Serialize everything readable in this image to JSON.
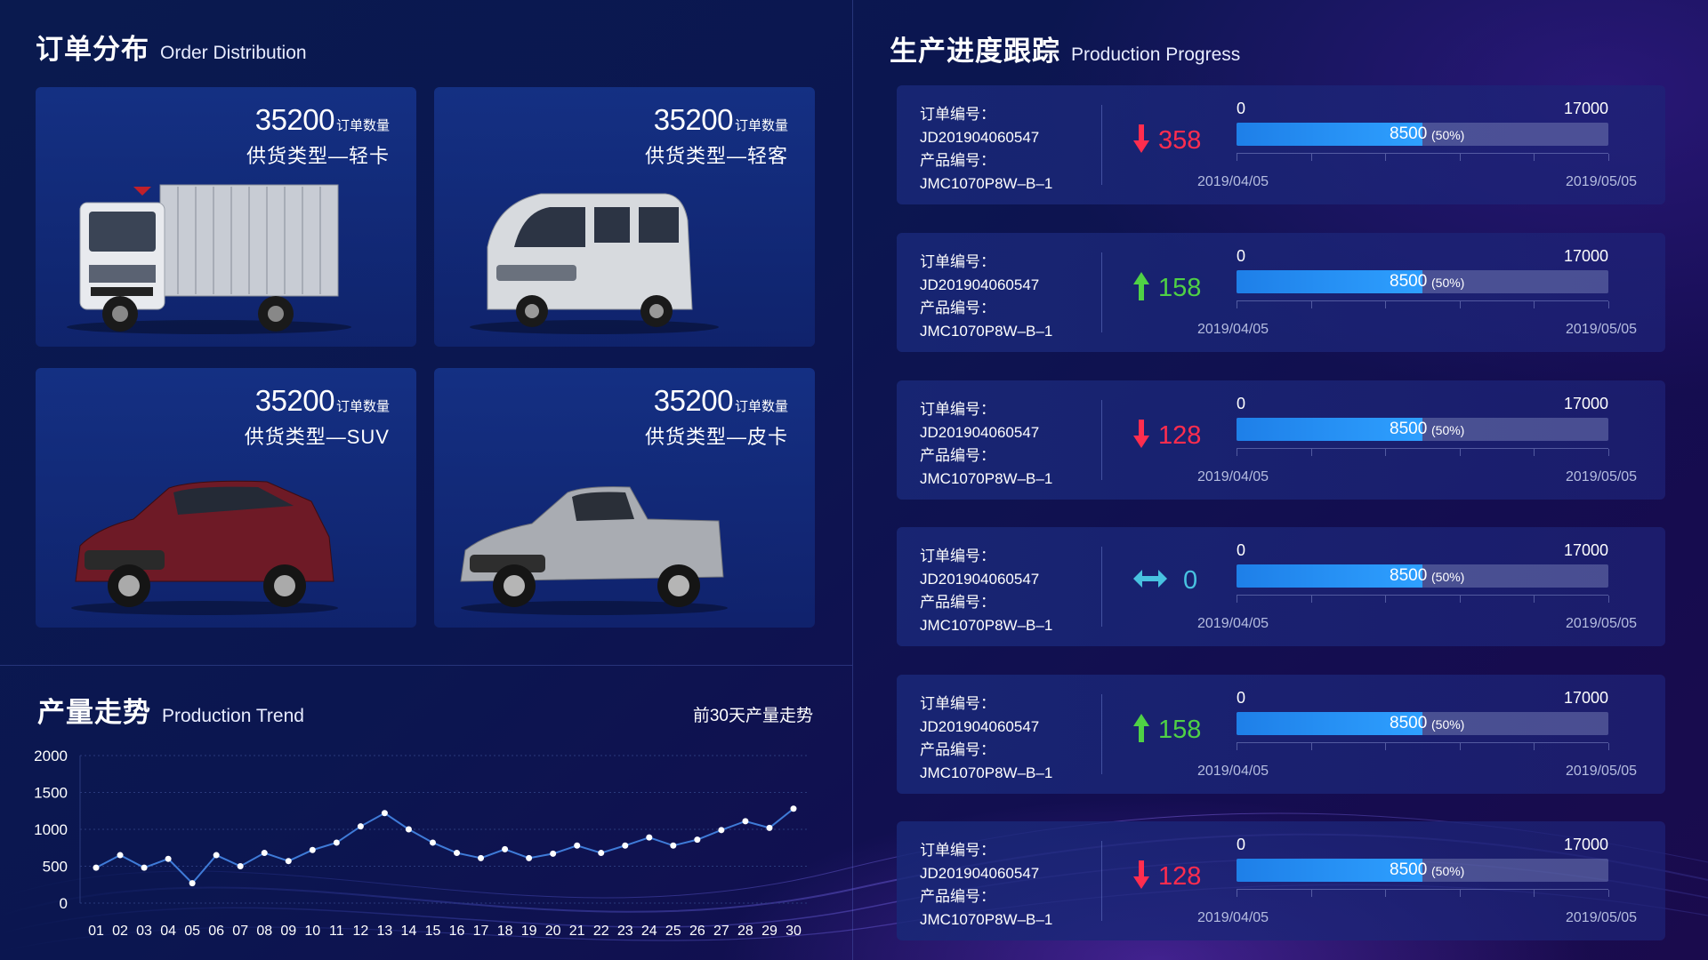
{
  "order_distribution": {
    "title_zh": "订单分布",
    "title_en": "Order Distribution",
    "cards": [
      {
        "count": "35200",
        "count_label": "订单数量",
        "type": "供货类型—轻卡",
        "vehicle": "light-truck"
      },
      {
        "count": "35200",
        "count_label": "订单数量",
        "type": "供货类型—轻客",
        "vehicle": "light-van"
      },
      {
        "count": "35200",
        "count_label": "订单数量",
        "type": "供货类型—SUV",
        "vehicle": "suv"
      },
      {
        "count": "35200",
        "count_label": "订单数量",
        "type": "供货类型—皮卡",
        "vehicle": "pickup"
      }
    ]
  },
  "production_trend": {
    "title_zh": "产量走势",
    "title_en": "Production Trend",
    "subtitle": "前30天产量走势"
  },
  "chart_data": {
    "type": "line",
    "categories": [
      "01",
      "02",
      "03",
      "04",
      "05",
      "06",
      "07",
      "08",
      "09",
      "10",
      "11",
      "12",
      "13",
      "14",
      "15",
      "16",
      "17",
      "18",
      "19",
      "20",
      "21",
      "22",
      "23",
      "24",
      "25",
      "26",
      "27",
      "28",
      "29",
      "30"
    ],
    "series": [
      {
        "values": [
          480,
          650,
          480,
          600,
          270,
          650,
          500,
          680,
          570,
          720,
          820,
          1040,
          1220,
          1000,
          820,
          680,
          610,
          730,
          610,
          670,
          780,
          680,
          780,
          890,
          780,
          860,
          990,
          1110,
          1020,
          1280
        ]
      }
    ],
    "ylim": [
      0,
      2000
    ],
    "yticks": [
      "0",
      "500",
      "1000",
      "1500",
      "2000"
    ],
    "colors": {
      "line": "#3f7bd8",
      "point": "#ffffff",
      "grid": "#2a3a7c"
    }
  },
  "production_progress": {
    "title_zh": "生产进度跟踪",
    "title_en": "Production Progress",
    "rows": [
      {
        "order_label": "订单编号：",
        "order_no": "JD201904060547",
        "product_label": "产品编号：",
        "product_no": "JMC1070P8W–B–1",
        "direction": "down",
        "delta": "358",
        "min": "0",
        "max": "17000",
        "value": "8500",
        "pct": "(50%)",
        "fraction": 0.5,
        "start": "2019/04/05",
        "end": "2019/05/05"
      },
      {
        "order_label": "订单编号：",
        "order_no": "JD201904060547",
        "product_label": "产品编号：",
        "product_no": "JMC1070P8W–B–1",
        "direction": "up",
        "delta": "158",
        "min": "0",
        "max": "17000",
        "value": "8500",
        "pct": "(50%)",
        "fraction": 0.5,
        "start": "2019/04/05",
        "end": "2019/05/05"
      },
      {
        "order_label": "订单编号：",
        "order_no": "JD201904060547",
        "product_label": "产品编号：",
        "product_no": "JMC1070P8W–B–1",
        "direction": "down",
        "delta": "128",
        "min": "0",
        "max": "17000",
        "value": "8500",
        "pct": "(50%)",
        "fraction": 0.5,
        "start": "2019/04/05",
        "end": "2019/05/05"
      },
      {
        "order_label": "订单编号：",
        "order_no": "JD201904060547",
        "product_label": "产品编号：",
        "product_no": "JMC1070P8W–B–1",
        "direction": "flat",
        "delta": "0",
        "min": "0",
        "max": "17000",
        "value": "8500",
        "pct": "(50%)",
        "fraction": 0.5,
        "start": "2019/04/05",
        "end": "2019/05/05"
      },
      {
        "order_label": "订单编号：",
        "order_no": "JD201904060547",
        "product_label": "产品编号：",
        "product_no": "JMC1070P8W–B–1",
        "direction": "up",
        "delta": "158",
        "min": "0",
        "max": "17000",
        "value": "8500",
        "pct": "(50%)",
        "fraction": 0.5,
        "start": "2019/04/05",
        "end": "2019/05/05"
      },
      {
        "order_label": "订单编号：",
        "order_no": "JD201904060547",
        "product_label": "产品编号：",
        "product_no": "JMC1070P8W–B–1",
        "direction": "down",
        "delta": "128",
        "min": "0",
        "max": "17000",
        "value": "8500",
        "pct": "(50%)",
        "fraction": 0.5,
        "start": "2019/04/05",
        "end": "2019/05/05"
      }
    ],
    "colors": {
      "down": "#ff2d4e",
      "up": "#4fd145",
      "flat": "#48c2e0",
      "bar": "#2a93f5"
    }
  }
}
